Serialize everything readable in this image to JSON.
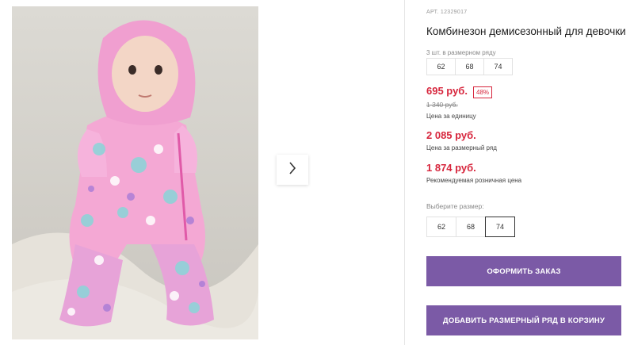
{
  "product": {
    "sku": "АРТ. 12329017",
    "title": "Комбинезон демисезонный для девочки"
  },
  "size_range": {
    "label": "3 шт. в размерном ряду",
    "sizes": [
      "62",
      "68",
      "74"
    ]
  },
  "pricing": {
    "unit_price": "695 руб.",
    "discount_badge": "48%",
    "old_price": "1 340 руб.",
    "unit_note": "Цена за единицу",
    "range_price": "2 085 руб.",
    "range_note": "Цена за размерный ряд",
    "retail_price": "1 874 руб.",
    "retail_note": "Рекомендуемая розничная цена"
  },
  "size_picker": {
    "label": "Выберите размер:",
    "options": [
      "62",
      "68",
      "74"
    ],
    "selected": "74"
  },
  "actions": {
    "order_label": "ОФОРМИТЬ ЗАКАЗ",
    "add_range_label": "ДОБАВИТЬ РАЗМЕРНЫЙ РЯД В КОРЗИНУ"
  },
  "icons": {
    "next": "chevron-right-icon"
  },
  "colors": {
    "accent": "#7b5aa6",
    "price": "#d7263d"
  }
}
